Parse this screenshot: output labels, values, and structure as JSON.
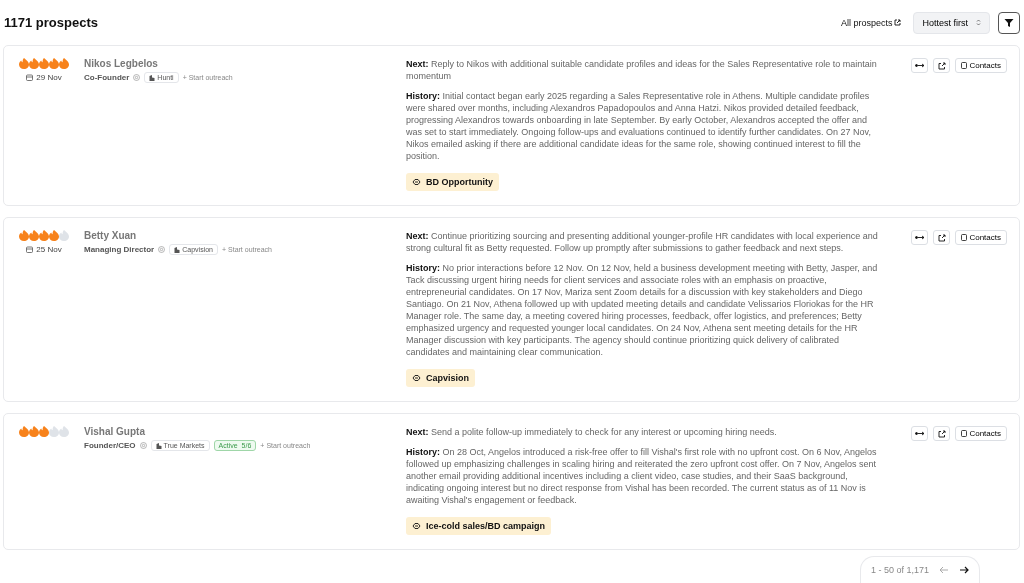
{
  "header": {
    "title": "1171 prospects",
    "link": "All prospects",
    "sort": "Hottest first"
  },
  "prospects": [
    {
      "stars": 5,
      "date": "29 Nov",
      "name": "Nikos Legbelos",
      "role": "Co-Founder",
      "company": "Hunti",
      "outreach": "+ Start outreach",
      "next_label": "Next:",
      "next": "Reply to Nikos with additional suitable candidate profiles and ideas for the Sales Representative role to maintain momentum",
      "history_label": "History:",
      "history": "Initial contact began early 2025 regarding a Sales Representative role in Athens. Multiple candidate profiles were shared over months, including Alexandros Papadopoulos and Anna Hatzi. Nikos provided detailed feedback, progressing Alexandros towards onboarding in late September. By early October, Alexandros accepted the offer and was set to start immediately. Ongoing follow-ups and evaluations continued to identify further candidates. On 27 Nov, Nikos emailed asking if there are additional candidate ideas for the same role, showing continued interest to fill the position.",
      "campaign": "BD Opportunity",
      "contacts": "Contacts"
    },
    {
      "stars": 4,
      "date": "25 Nov",
      "name": "Betty Xuan",
      "role": "Managing Director",
      "company": "Capvision",
      "outreach": "+ Start outreach",
      "next_label": "Next:",
      "next": "Continue prioritizing sourcing and presenting additional younger-profile HR candidates with local experience and strong cultural fit as Betty requested. Follow up promptly after submissions to gather feedback and next steps.",
      "history_label": "History:",
      "history": "No prior interactions before 12 Nov. On 12 Nov, held a business development meeting with Betty, Jasper, and Tack discussing urgent hiring needs for client services and associate roles with an emphasis on proactive, entrepreneurial candidates. On 17 Nov, Mariza sent Zoom details for a discussion with key stakeholders and Diego Santiago. On 21 Nov, Athena followed up with updated meeting details and candidate Velissarios Floriokas for the HR Manager role. The same day, a meeting covered hiring processes, feedback, offer logistics, and preferences; Betty emphasized urgency and requested younger local candidates. On 24 Nov, Athena sent meeting details for the HR Manager discussion with key participants. The agency should continue prioritizing quick delivery of calibrated candidates and maintaining clear communication.",
      "campaign": "Capvision",
      "contacts": "Contacts"
    },
    {
      "stars": 3,
      "name": "Vishal Gupta",
      "role": "Founder/CEO",
      "company": "True Markets",
      "status": {
        "label": "Active",
        "count": "5/6"
      },
      "outreach": "+ Start outreach",
      "next_label": "Next:",
      "next": "Send a polite follow-up immediately to check for any interest or upcoming hiring needs.",
      "history_label": "History:",
      "history": "On 28 Oct, Angelos introduced a risk-free offer to fill Vishal's first role with no upfront cost. On 6 Nov, Angelos followed up emphasizing challenges in scaling hiring and reiterated the zero upfront cost offer. On 7 Nov, Angelos sent another email providing additional incentives including a client video, case studies, and their SaaS background, indicating ongoing interest but no direct response from Vishal has been recorded. The current status as of 11 Nov is awaiting Vishal's engagement or feedback.",
      "campaign": "Ice-cold sales/BD campaign",
      "contacts": "Contacts"
    }
  ],
  "pagination": {
    "range": "1 - 50 of 1,171"
  }
}
